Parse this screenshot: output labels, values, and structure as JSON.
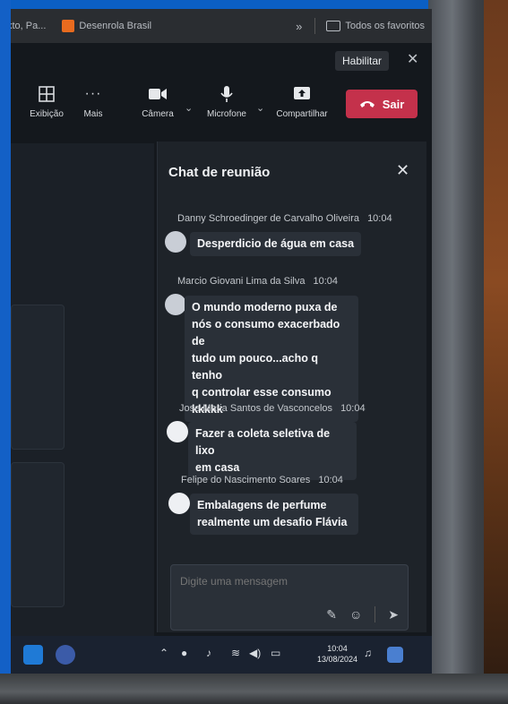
{
  "browser": {
    "bookmarks": [
      "xto, Pa...",
      "Desenrola Brasil"
    ],
    "more": "»",
    "favorites": "Todos os favoritos"
  },
  "notification": {
    "enable_label": "Habilitar",
    "close": "✕"
  },
  "toolbar": {
    "view_label": "Exibição",
    "more_label": "Mais",
    "camera_label": "Câmera",
    "mic_label": "Microfone",
    "share_label": "Compartilhar",
    "leave_label": "Sair"
  },
  "chat": {
    "title": "Chat de reunião",
    "messages": [
      {
        "sender": "Danny Schroedinger de Carvalho Oliveira",
        "time": "10:04",
        "lines": [
          "Desperdicio de água em casa"
        ]
      },
      {
        "sender": "Marcio Giovani Lima da Silva",
        "time": "10:04",
        "lines": [
          "O mundo moderno puxa de",
          "nós o consumo exacerbado de",
          "tudo um pouco...acho q tenho",
          "q controlar esse consumo",
          "kkkkk"
        ]
      },
      {
        "sender": "Jose Maria Santos de Vasconcelos",
        "time": "10:04",
        "lines": [
          "Fazer a coleta seletiva de lixo",
          "em casa"
        ]
      },
      {
        "sender": "Felipe do Nascimento Soares",
        "time": "10:04",
        "lines": [
          "Embalagens de perfume",
          "realmente um desafio Flávia"
        ]
      }
    ],
    "compose_placeholder": "Digite uma mensagem"
  },
  "taskbar": {
    "time": "10:04",
    "date": "13/08/2024"
  },
  "colors": {
    "leave": "#c4314b",
    "panel": "#1e2329",
    "frame": "#0b5fc4"
  }
}
